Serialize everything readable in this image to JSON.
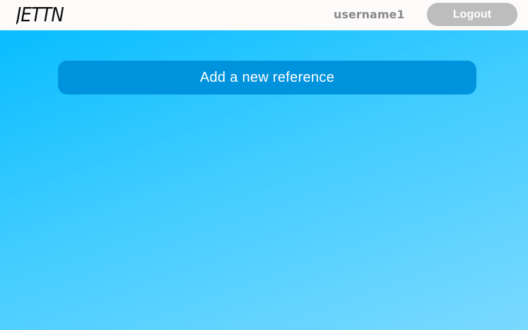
{
  "header": {
    "logo_text": "JETTN",
    "username": "username1",
    "logout_label": "Logout"
  },
  "main": {
    "add_reference_label": "Add a new reference"
  },
  "colors": {
    "header_background": "#fdfafa",
    "page_gradient_start": "#00bbff",
    "page_gradient_end": "#7ad9ff",
    "add_button_background": "#0093dd",
    "logout_button_background": "#bdbdbd",
    "username_text": "#8a8a8a"
  }
}
